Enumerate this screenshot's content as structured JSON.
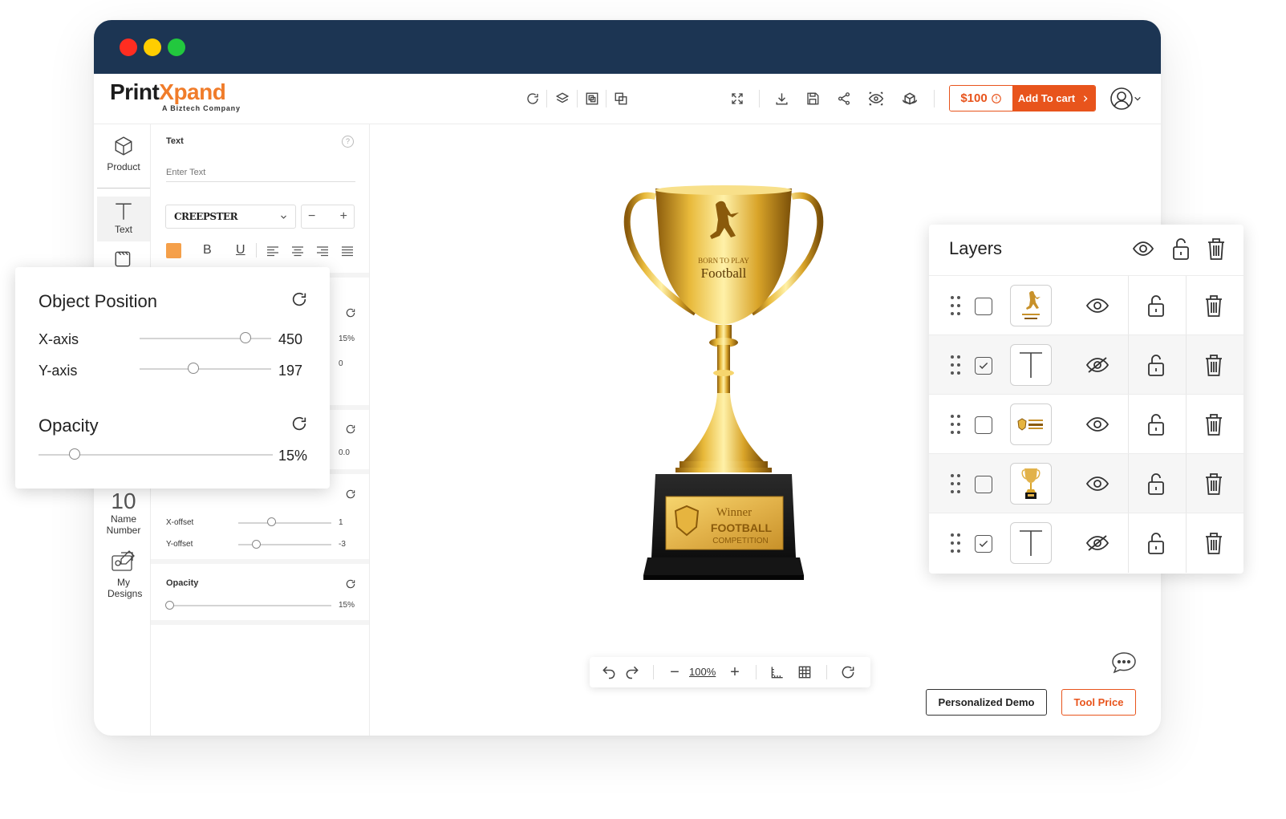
{
  "brand": {
    "name_a": "Print",
    "name_b": "Xpand",
    "tagline": "A Biztech Company"
  },
  "header": {
    "price": "$100",
    "cart_label": "Add To cart"
  },
  "nav": [
    {
      "label": "Product",
      "icon": "cube-icon"
    },
    {
      "label": "Text",
      "icon": "text-icon"
    },
    {
      "label": "10",
      "sublabel": "Name Number",
      "icon": "name-number-icon"
    },
    {
      "label": "My Designs",
      "icon": "my-designs-icon"
    }
  ],
  "text_panel": {
    "title": "Text",
    "placeholder": "Enter Text",
    "font": "CREEPSTER",
    "accent_color": "#f5a04a",
    "style_buttons": [
      "B",
      "U"
    ],
    "values_a": [
      "15%",
      "0"
    ],
    "value_b": "0.0",
    "offsets": [
      {
        "label": "X-offset",
        "value": "1",
        "level": 0.36
      },
      {
        "label": "Y-offset",
        "value": "-3",
        "level": 0.19
      }
    ],
    "opacity_label": "Opacity",
    "opacity_value": "15%"
  },
  "object_position": {
    "title": "Object Position",
    "x_label": "X-axis",
    "x_value": "450",
    "x_level": 0.81,
    "y_label": "Y-axis",
    "y_value": "197",
    "y_level": 0.4,
    "opacity_title": "Opacity",
    "opacity_value": "15%",
    "opacity_level": 0.15
  },
  "trophy": {
    "cup_line1": "BORN TO PLAY",
    "cup_line2": "Football",
    "plate_line1": "Winner",
    "plate_line2": "FOOTBALL",
    "plate_line3": "COMPETITION"
  },
  "zoom": {
    "value": "100%"
  },
  "footer": {
    "demo_label": "Personalized Demo",
    "price_label": "Tool Price"
  },
  "layers": {
    "title": "Layers",
    "rows": [
      {
        "checked": false,
        "thumb": "player-logo",
        "visible": true
      },
      {
        "checked": true,
        "thumb": "text",
        "visible": false
      },
      {
        "checked": false,
        "thumb": "badge",
        "visible": true
      },
      {
        "checked": false,
        "thumb": "trophy",
        "visible": true
      },
      {
        "checked": true,
        "thumb": "text",
        "visible": false
      }
    ]
  },
  "colors": {
    "titlebar": "#1c3553",
    "accent": "#e8541c",
    "brand_orange": "#f07c2a",
    "gold": "#d4a017"
  }
}
